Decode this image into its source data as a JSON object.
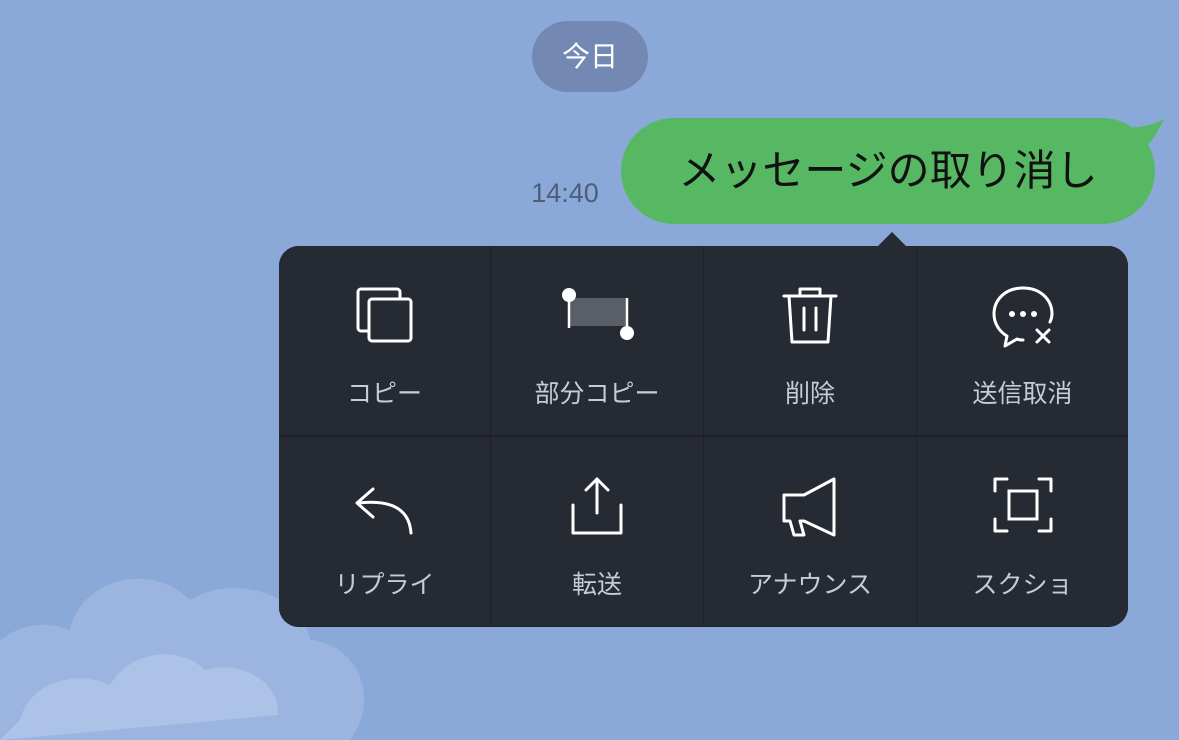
{
  "chat": {
    "date_label": "今日",
    "timestamp": "14:40",
    "message": "メッセージの取り消し"
  },
  "menu": {
    "items": [
      {
        "label": "コピー",
        "icon": "copy-icon"
      },
      {
        "label": "部分コピー",
        "icon": "partial-copy-icon"
      },
      {
        "label": "削除",
        "icon": "trash-icon"
      },
      {
        "label": "送信取消",
        "icon": "unsend-icon"
      },
      {
        "label": "リプライ",
        "icon": "reply-icon"
      },
      {
        "label": "転送",
        "icon": "share-icon"
      },
      {
        "label": "アナウンス",
        "icon": "megaphone-icon"
      },
      {
        "label": "スクショ",
        "icon": "screenshot-icon"
      }
    ]
  },
  "colors": {
    "background": "#8aa9d9",
    "bubble": "#57b863",
    "menu": "#262a33",
    "date_pill": "#7389b3"
  }
}
